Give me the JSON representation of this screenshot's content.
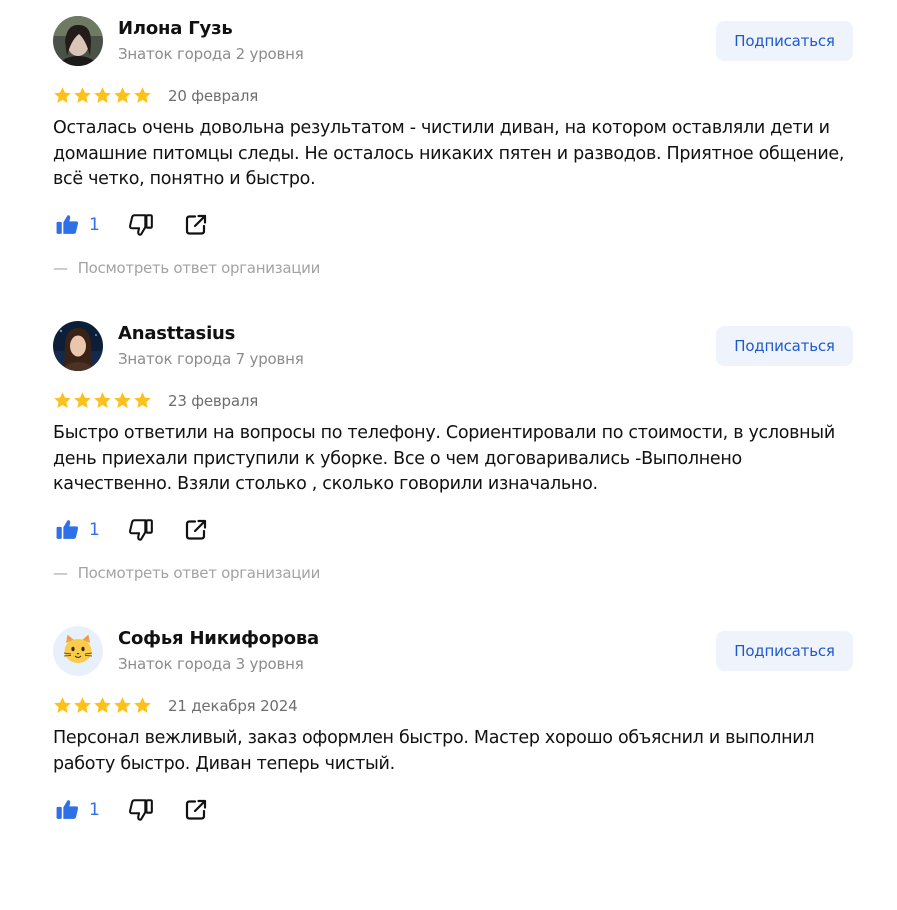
{
  "reviews": [
    {
      "author_name": "Илона Гузь",
      "author_level": "Знаток города 2 уровня",
      "subscribe_label": "Подписаться",
      "rating": 5,
      "date": "20 февраля",
      "text": "Осталась очень довольна результатом - чистили диван, на котором оставляли дети и домашние питомцы следы. Не осталось никаких пятен и разводов. Приятное общение, всё четко, понятно и быстро.",
      "likes": "1",
      "reply_link": "Посмотреть ответ организации"
    },
    {
      "author_name": "Anasttasius",
      "author_level": "Знаток города 7 уровня",
      "subscribe_label": "Подписаться",
      "rating": 5,
      "date": "23 февраля",
      "text": "Быстро ответили на вопросы по телефону. Сориентировали по стоимости, в условный день приехали приступили к уборке. Все о чем договаривались -Выполнено качественно. Взяли столько , сколько говорили изначально.",
      "likes": "1",
      "reply_link": "Посмотреть ответ организации"
    },
    {
      "author_name": "Софья Никифорова",
      "author_level": "Знаток города 3 уровня",
      "subscribe_label": "Подписаться",
      "rating": 5,
      "date": "21 декабря 2024",
      "text": "Персонал вежливый, заказ оформлен быстро. Мастер хорошо объяснил и выполнил работу быстро. Диван теперь чистый.",
      "likes": "1"
    }
  ],
  "colors": {
    "star": "#fcc21b",
    "like": "#2f6fe8",
    "subscribe_bg": "#eff4fc",
    "subscribe_text": "#1f59d1",
    "muted": "#8c8c8c"
  },
  "icons": {
    "like": "thumb-up-icon",
    "dislike": "thumb-down-icon",
    "share": "share-icon",
    "star": "star-icon",
    "avatar_3": "cat-face-emoji"
  }
}
